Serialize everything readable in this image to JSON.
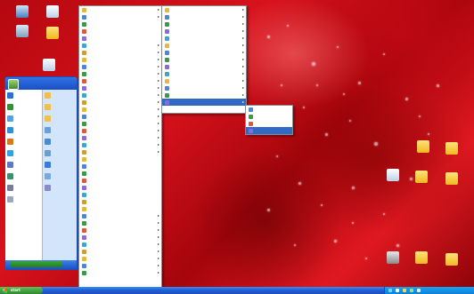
{
  "colors": {
    "taskbar": "#1f5fd6",
    "start_button": "#2c8a2c",
    "highlight": "#316ac5",
    "wallpaper_accent": "#c40c14"
  },
  "taskbar": {
    "start_label": "start",
    "clock": "",
    "tray_icons": [
      "network-icon",
      "volume-icon",
      "security-icon",
      "update-icon",
      "clock-icon"
    ]
  },
  "desktop_icons": [
    {
      "name": "desktop-icon-my-computer",
      "icon": "computer-icon",
      "label": ""
    },
    {
      "name": "desktop-icon-messenger",
      "icon": "messenger-icon",
      "label": ""
    },
    {
      "name": "desktop-icon-recycle",
      "icon": "recycle-bin-icon",
      "label": ""
    },
    {
      "name": "desktop-icon-chat",
      "icon": "chat-icon",
      "label": ""
    },
    {
      "name": "desktop-icon-app",
      "icon": "app-icon",
      "label": ""
    },
    {
      "name": "desktop-icon-folder-1",
      "icon": "folder-icon",
      "label": ""
    },
    {
      "name": "desktop-icon-folder-2",
      "icon": "folder-icon",
      "label": ""
    },
    {
      "name": "desktop-icon-document",
      "icon": "document-icon",
      "label": ""
    },
    {
      "name": "desktop-icon-folder-3",
      "icon": "folder-icon",
      "label": ""
    },
    {
      "name": "desktop-icon-folder-4",
      "icon": "folder-icon",
      "label": ""
    },
    {
      "name": "desktop-icon-drive",
      "icon": "drive-icon",
      "label": ""
    },
    {
      "name": "desktop-icon-folder-5",
      "icon": "folder-icon",
      "label": ""
    },
    {
      "name": "desktop-icon-folder-6",
      "icon": "folder-icon",
      "label": ""
    }
  ],
  "start_menu": {
    "user_name": "",
    "all_programs_label": "",
    "left_items": [
      {
        "icon": "internet-icon",
        "label": ""
      },
      {
        "icon": "email-icon",
        "label": ""
      },
      {
        "icon": "windows-icon",
        "label": ""
      },
      {
        "icon": "paint-icon",
        "label": ""
      },
      {
        "icon": "media-player-icon",
        "label": ""
      },
      {
        "icon": "messenger-icon",
        "label": ""
      },
      {
        "icon": "tour-icon",
        "label": ""
      },
      {
        "icon": "transfer-icon",
        "label": ""
      },
      {
        "icon": "calculator-icon",
        "label": ""
      },
      {
        "icon": "notepad-icon",
        "label": ""
      }
    ],
    "right_items": [
      {
        "icon": "documents-icon",
        "label": ""
      },
      {
        "icon": "pictures-icon",
        "label": ""
      },
      {
        "icon": "music-icon",
        "label": ""
      },
      {
        "icon": "computer-icon",
        "label": ""
      },
      {
        "icon": "network-icon",
        "label": ""
      },
      {
        "icon": "control-panel-icon",
        "label": ""
      },
      {
        "icon": "help-icon",
        "label": ""
      },
      {
        "icon": "search-icon",
        "label": ""
      },
      {
        "icon": "run-icon",
        "label": ""
      }
    ]
  },
  "programs_menu": {
    "items": [
      {
        "label": "",
        "arrow": true
      },
      {
        "label": "",
        "arrow": true
      },
      {
        "label": "",
        "arrow": false
      },
      {
        "label": "",
        "arrow": false
      },
      {
        "label": "",
        "arrow": false
      },
      {
        "label": "",
        "arrow": true
      },
      {
        "label": "",
        "arrow": true
      },
      {
        "label": "",
        "arrow": true
      },
      {
        "label": "",
        "arrow": true
      },
      {
        "label": "",
        "arrow": true
      },
      {
        "label": "",
        "arrow": true
      },
      {
        "label": "",
        "arrow": true
      },
      {
        "label": "",
        "arrow": true
      },
      {
        "label": "",
        "arrow": true
      },
      {
        "label": "",
        "arrow": true
      },
      {
        "label": "",
        "arrow": true
      },
      {
        "label": "",
        "arrow": true
      },
      {
        "label": "",
        "arrow": true
      },
      {
        "label": "",
        "arrow": true
      },
      {
        "label": "",
        "arrow": true
      },
      {
        "label": "",
        "arrow": true
      },
      {
        "label": "",
        "arrow": false
      },
      {
        "label": "",
        "arrow": false
      },
      {
        "label": "",
        "arrow": false
      },
      {
        "label": "",
        "arrow": false
      },
      {
        "label": "",
        "arrow": false
      },
      {
        "label": "",
        "arrow": false
      },
      {
        "label": "",
        "arrow": false
      },
      {
        "label": "",
        "arrow": false
      },
      {
        "label": "",
        "arrow": true
      },
      {
        "label": "",
        "arrow": true
      },
      {
        "label": "",
        "arrow": true
      },
      {
        "label": "",
        "arrow": true
      },
      {
        "label": "",
        "arrow": true
      },
      {
        "label": "",
        "arrow": true
      },
      {
        "label": "",
        "arrow": true
      },
      {
        "label": "",
        "arrow": true
      },
      {
        "label": "",
        "arrow": true
      }
    ]
  },
  "submenu": {
    "items": [
      {
        "label": "",
        "arrow": true
      },
      {
        "label": "",
        "arrow": true
      },
      {
        "label": "",
        "arrow": true
      },
      {
        "label": "",
        "arrow": true
      },
      {
        "label": "",
        "arrow": true
      },
      {
        "label": "",
        "arrow": true
      },
      {
        "label": "",
        "arrow": true
      },
      {
        "label": "",
        "arrow": true
      },
      {
        "label": "",
        "arrow": true
      },
      {
        "label": "",
        "arrow": true
      },
      {
        "label": "",
        "arrow": true
      },
      {
        "label": "",
        "arrow": true
      },
      {
        "label": "",
        "arrow": true
      },
      {
        "label": "",
        "arrow": true,
        "highlighted": true
      }
    ]
  },
  "flyout": {
    "items": [
      {
        "label": ""
      },
      {
        "label": ""
      },
      {
        "label": ""
      },
      {
        "label": "",
        "highlighted": true
      }
    ]
  }
}
